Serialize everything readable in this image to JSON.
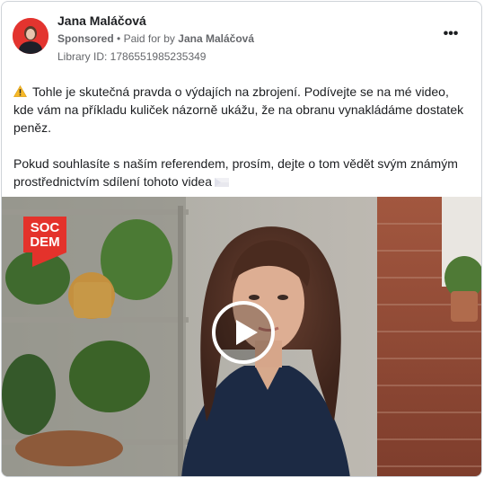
{
  "post": {
    "page_name": "Jana Maláčová",
    "sponsored_label": "Sponsored",
    "paid_for_prefix": "Paid for by",
    "paid_for_name": "Jana Maláčová",
    "library_id": "Library ID: 1786551985235349",
    "text_paragraph_1": "Tohle je skutečná pravda o výdajích na zbrojení. Podívejte se na mé video, kde vám na příkladu kuliček názorně ukážu, že na obranu vynakládáme dostatek peněz.",
    "text_paragraph_2": "Pokud souhlasíte s naším referendem, prosím, dejte o tom vědět svým známým prostřednictvím sdílení tohoto videa"
  },
  "video": {
    "logo_line_1": "SOC",
    "logo_line_2": "DEM",
    "logo_color": "#e4322b"
  },
  "icons": {
    "warning": "warning-icon",
    "flag": "czech-flag-icon",
    "more": "more-options-icon",
    "play": "play-icon"
  }
}
